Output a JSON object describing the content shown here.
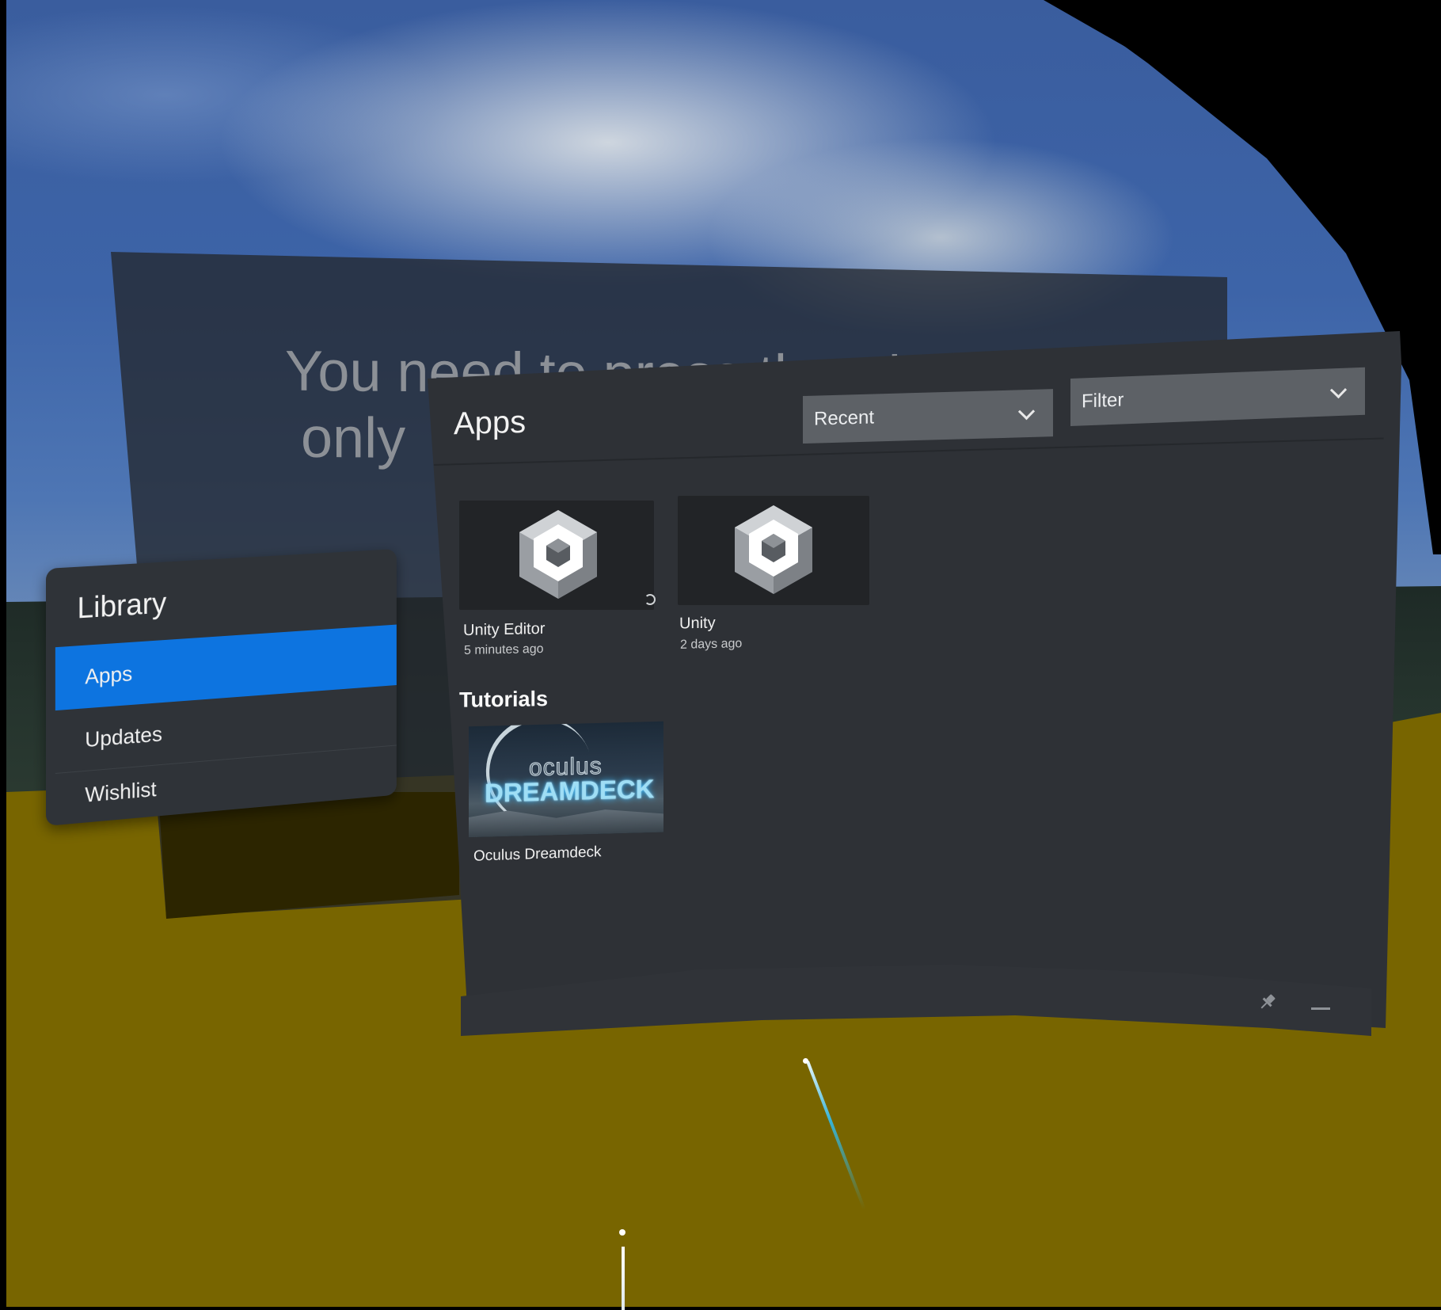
{
  "environment": {
    "background_message": "You need to press the tri\n only",
    "colors": {
      "ground": "#786500",
      "sky": "#3d64a8"
    }
  },
  "library": {
    "title": "Library",
    "items": [
      {
        "label": "Apps",
        "active": true
      },
      {
        "label": "Updates",
        "active": false
      },
      {
        "label": "Wishlist",
        "active": false
      }
    ],
    "accent": "#0d74e0"
  },
  "apps": {
    "title": "Apps",
    "sort_dropdown": {
      "value": "Recent",
      "icon": "chevron-down-icon"
    },
    "filter_dropdown": {
      "value": "Filter",
      "icon": "chevron-down-icon"
    },
    "recent_apps": [
      {
        "name": "Unity Editor",
        "time": "5 minutes ago",
        "icon": "unity-logo-icon",
        "loading": true
      },
      {
        "name": "Unity",
        "time": "2 days ago",
        "icon": "unity-logo-icon",
        "loading": false
      }
    ],
    "tutorials_title": "Tutorials",
    "tutorials": [
      {
        "name": "Oculus Dreamdeck",
        "art_line1": "oculus",
        "art_line2": "DREAMDECK"
      }
    ],
    "footer_icons": [
      "pin-icon",
      "minimize-icon"
    ]
  }
}
